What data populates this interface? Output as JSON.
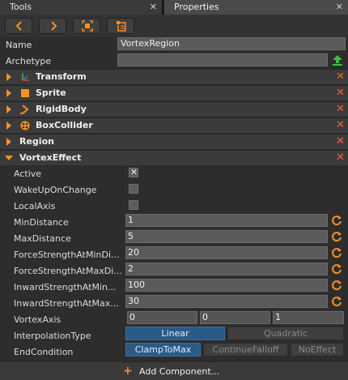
{
  "tabs": [
    {
      "label": "Tools",
      "close": "✕"
    },
    {
      "label": "Properties",
      "close": "✕"
    }
  ],
  "toolbar": {
    "buttons": [
      "back-icon",
      "forward-icon",
      "select-object-icon",
      "history-icon"
    ]
  },
  "name": {
    "label": "Name",
    "value": "VortexRegion"
  },
  "archetype": {
    "label": "Archetype",
    "value": ""
  },
  "components": {
    "transform": {
      "label": "Transform",
      "close": "✕"
    },
    "sprite": {
      "label": "Sprite",
      "close": "✕"
    },
    "rigidbody": {
      "label": "RigidBody",
      "close": "✕"
    },
    "boxcollider": {
      "label": "BoxCollider",
      "close": "✕"
    },
    "region": {
      "label": "Region",
      "close": "✕"
    },
    "vortexeffect": {
      "label": "VortexEffect",
      "close": "✕"
    }
  },
  "vortex": {
    "active": {
      "label": "Active",
      "checked": true,
      "mark": "✕"
    },
    "wakeup": {
      "label": "WakeUpOnChange",
      "checked": false
    },
    "localaxis": {
      "label": "LocalAxis",
      "checked": false
    },
    "mindistance": {
      "label": "MinDistance",
      "value": "1"
    },
    "maxdistance": {
      "label": "MaxDistance",
      "value": "5"
    },
    "forcemin": {
      "label": "ForceStrengthAtMinDi...",
      "value": "20"
    },
    "forcemax": {
      "label": "ForceStrengthAtMaxDi...",
      "value": "2"
    },
    "inwardmin": {
      "label": "InwardStrengthAtMin...",
      "value": "100"
    },
    "inwardmax": {
      "label": "InwardStrengthAtMax...",
      "value": "30"
    },
    "axis": {
      "label": "VortexAxis",
      "x": "0",
      "y": "0",
      "z": "1"
    },
    "interpolation": {
      "label": "InterpolationType",
      "options": [
        "Linear",
        "Quadratic"
      ],
      "selected": "Linear"
    },
    "endcondition": {
      "label": "EndCondition",
      "options": [
        "ClampToMax",
        "ContinueFalloff",
        "NoEffect"
      ],
      "selected": "ClampToMax"
    }
  },
  "add_component": {
    "plus": "+",
    "label": "Add Component..."
  },
  "colors": {
    "accent": "#f59222",
    "close": "#f0642a",
    "selected": "#2a5a86",
    "upload": "#3cbf3c"
  }
}
